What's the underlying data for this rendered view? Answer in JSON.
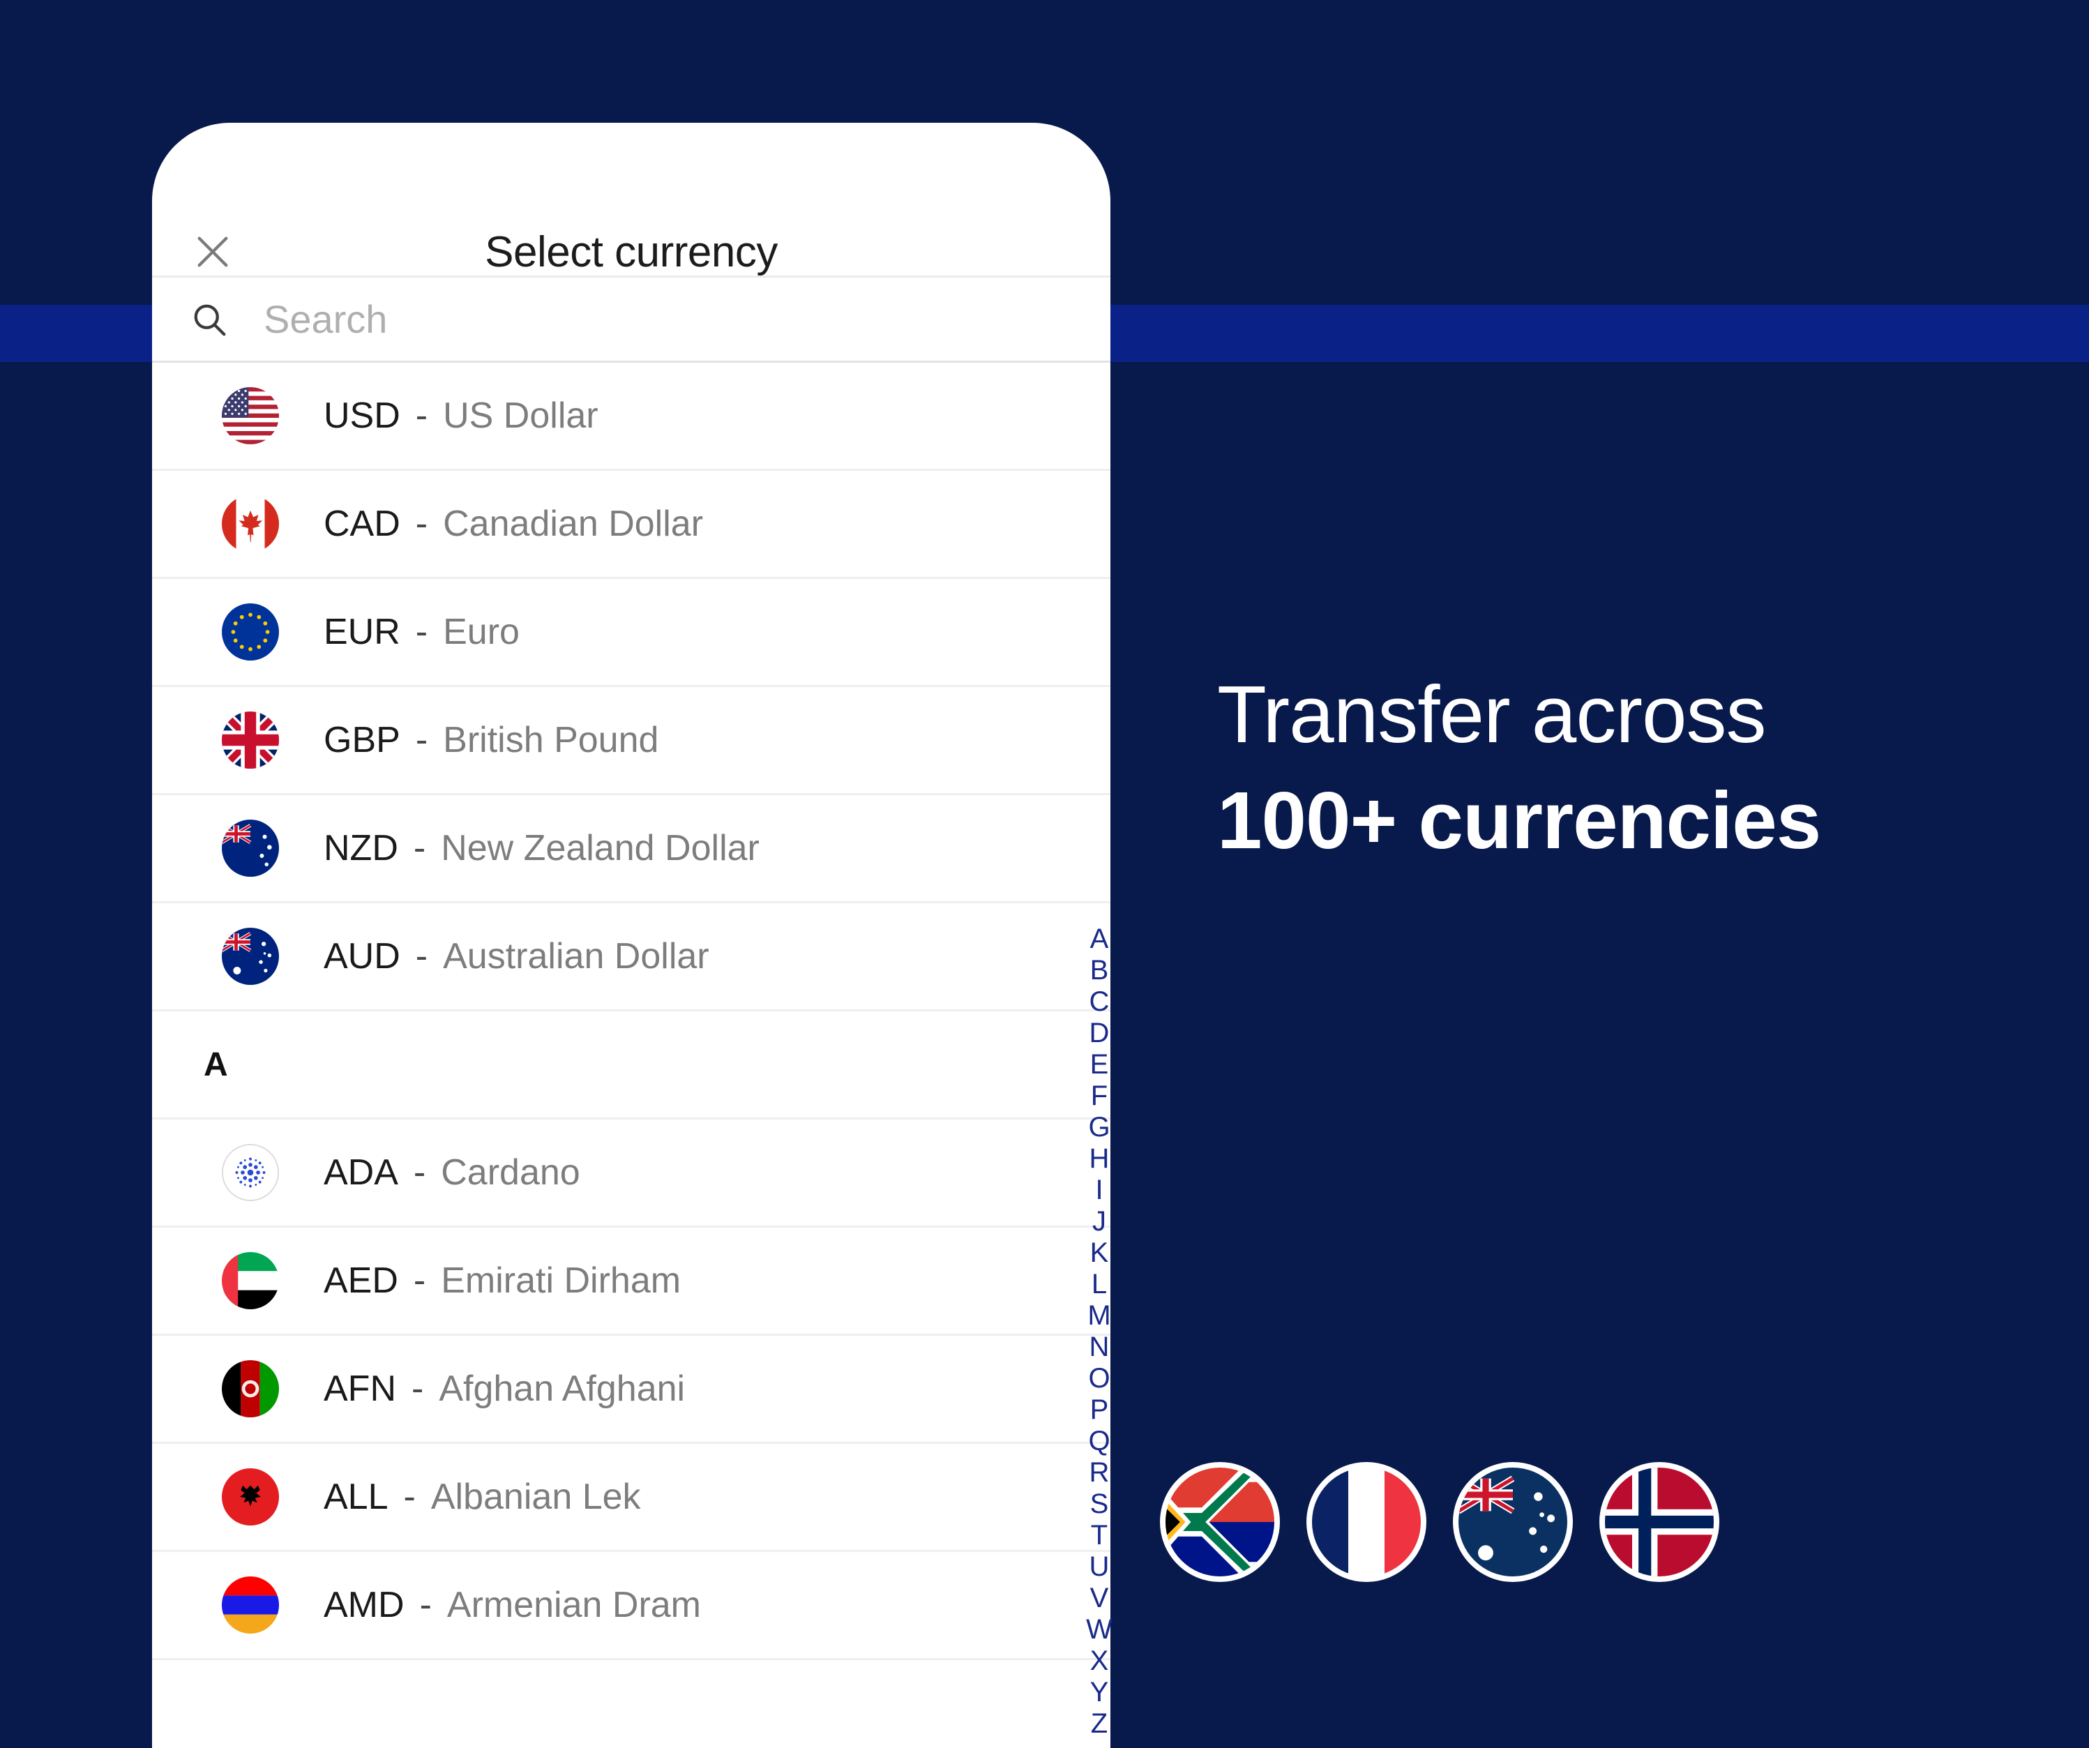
{
  "theme": {
    "background": "#08194B",
    "band": "#0A2288",
    "card_bg": "#FFFFFF",
    "index_letter_color": "#1A2A8A",
    "code_color": "#1A1A1A",
    "name_color": "#7D7D7D",
    "marketing_text_color": "#FFFFFF"
  },
  "modal": {
    "title": "Select currency",
    "close_icon": "close-icon",
    "search": {
      "icon": "search-icon",
      "placeholder": "Search",
      "value": ""
    }
  },
  "list": {
    "popular": [
      {
        "code": "USD",
        "separator": "-",
        "name": "US Dollar",
        "flag": "us"
      },
      {
        "code": "CAD",
        "separator": "-",
        "name": "Canadian Dollar",
        "flag": "ca"
      },
      {
        "code": "EUR",
        "separator": "-",
        "name": "Euro",
        "flag": "eu"
      },
      {
        "code": "GBP",
        "separator": "-",
        "name": "British Pound",
        "flag": "gb"
      },
      {
        "code": "NZD",
        "separator": "-",
        "name": "New Zealand Dollar",
        "flag": "nz"
      },
      {
        "code": "AUD",
        "separator": "-",
        "name": "Australian Dollar",
        "flag": "au"
      }
    ],
    "section_a_label": "A",
    "section_a": [
      {
        "code": "ADA",
        "separator": "-",
        "name": "Cardano",
        "flag": "ada"
      },
      {
        "code": "AED",
        "separator": "-",
        "name": "Emirati Dirham",
        "flag": "ae"
      },
      {
        "code": "AFN",
        "separator": "-",
        "name": "Afghan Afghani",
        "flag": "af"
      },
      {
        "code": "ALL",
        "separator": "-",
        "name": "Albanian Lek",
        "flag": "al"
      },
      {
        "code": "AMD",
        "separator": "-",
        "name": "Armenian Dram",
        "flag": "am"
      }
    ]
  },
  "alphabet_index": [
    "A",
    "B",
    "C",
    "D",
    "E",
    "F",
    "G",
    "H",
    "I",
    "J",
    "K",
    "L",
    "M",
    "N",
    "O",
    "P",
    "Q",
    "R",
    "S",
    "T",
    "U",
    "V",
    "W",
    "X",
    "Y",
    "Z"
  ],
  "marketing": {
    "line1": "Transfer across",
    "line2": "100+ currencies"
  },
  "flag_strip": [
    {
      "name": "south-africa-flag",
      "flag": "za"
    },
    {
      "name": "france-flag",
      "flag": "fr"
    },
    {
      "name": "australia-flag",
      "flag": "au"
    },
    {
      "name": "norway-flag",
      "flag": "no"
    }
  ]
}
